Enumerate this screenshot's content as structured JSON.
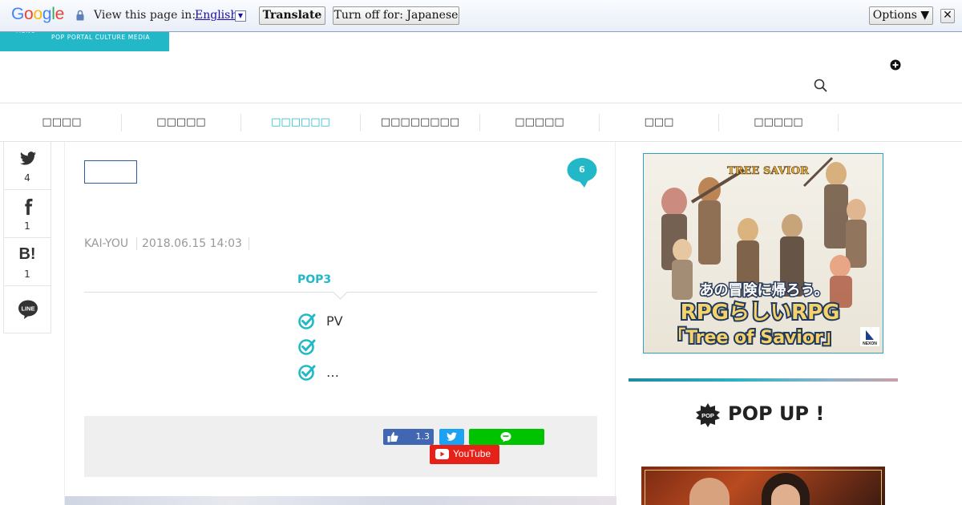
{
  "translate_bar": {
    "logo": "Google",
    "prompt": "View this page in:",
    "language": "English",
    "translate_label": "Translate",
    "turn_off_label": "Turn off for: Japanese",
    "options_label": "Options ▼",
    "close_label": "✕"
  },
  "header": {
    "menu_label": "MENU",
    "tagline": "POP PORTAL CULTURE MEDIA"
  },
  "nav": {
    "items": [
      {
        "label": "□□□□"
      },
      {
        "label": "□□□□□"
      },
      {
        "label": "□□□□□□"
      },
      {
        "label": "□□□□□□□□"
      },
      {
        "label": "□□□□□"
      },
      {
        "label": "□□□"
      },
      {
        "label": "□□□□□"
      }
    ],
    "active_index": 2
  },
  "share_sidebar": {
    "twitter_count": "4",
    "facebook_count": "1",
    "hatena_label": "B!",
    "hatena_count": "1",
    "line_label": "LINE"
  },
  "article": {
    "comment_count": "6",
    "author": "KAI-YOU",
    "date": "2018.06.15 14:03",
    "pop3_label": "POP3",
    "pop3_items": [
      {
        "text": "PV"
      },
      {
        "text": ""
      },
      {
        "text": "…"
      }
    ],
    "share_buttons": {
      "fb_count": "1.3",
      "youtube_label": "YouTube"
    }
  },
  "sidebar": {
    "ad": {
      "logo_text": "TREE SAVIOR",
      "catch": "あの冒険に帰ろう。",
      "line1": "RPGらしいRPG",
      "line2": "「Tree of Savior」",
      "publisher": "NEXON"
    },
    "popup": {
      "badge": "POP",
      "title": "POP UP !"
    }
  },
  "colors": {
    "accent": "#22b8c8",
    "facebook": "#4267b2",
    "twitter": "#1da1f2",
    "line": "#00c300",
    "youtube": "#e62117"
  }
}
